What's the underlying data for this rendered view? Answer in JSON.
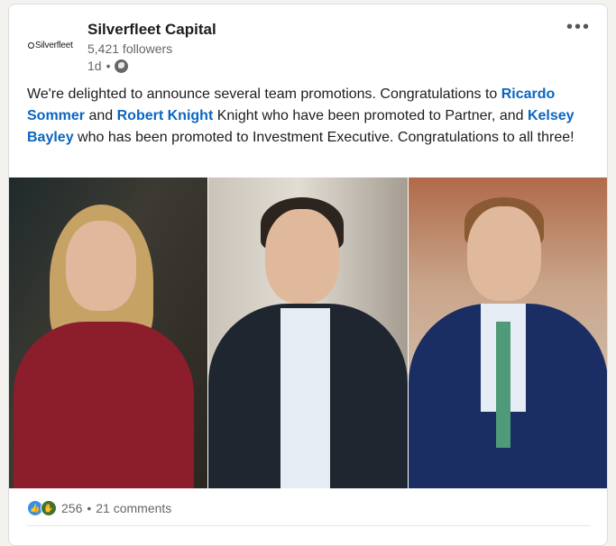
{
  "post": {
    "company_name": "Silverfleet Capital",
    "logo_text": "Silverfleet",
    "followers": "5,421 followers",
    "time": "1d",
    "dot": "•",
    "more_menu": "•••",
    "text": {
      "p1": "We're delighted to announce several team promotions. Congratulations to ",
      "mention1": "Ricardo Sommer",
      "p2": " and ",
      "mention2": "Robert Knight",
      "p3": " Knight who have been promoted to Partner, and ",
      "mention3": "Kelsey Bayley",
      "p4": " who has been promoted to Investment Executive. Congratulations to all three!"
    },
    "icons": {
      "visibility": "globe-icon",
      "like": "like-icon",
      "celebrate": "celebrate-icon"
    }
  },
  "social": {
    "reaction_count": "256",
    "separator": "•",
    "comments": "21 comments"
  },
  "colors": {
    "link": "#0a66c2",
    "like": "#378fe9"
  }
}
